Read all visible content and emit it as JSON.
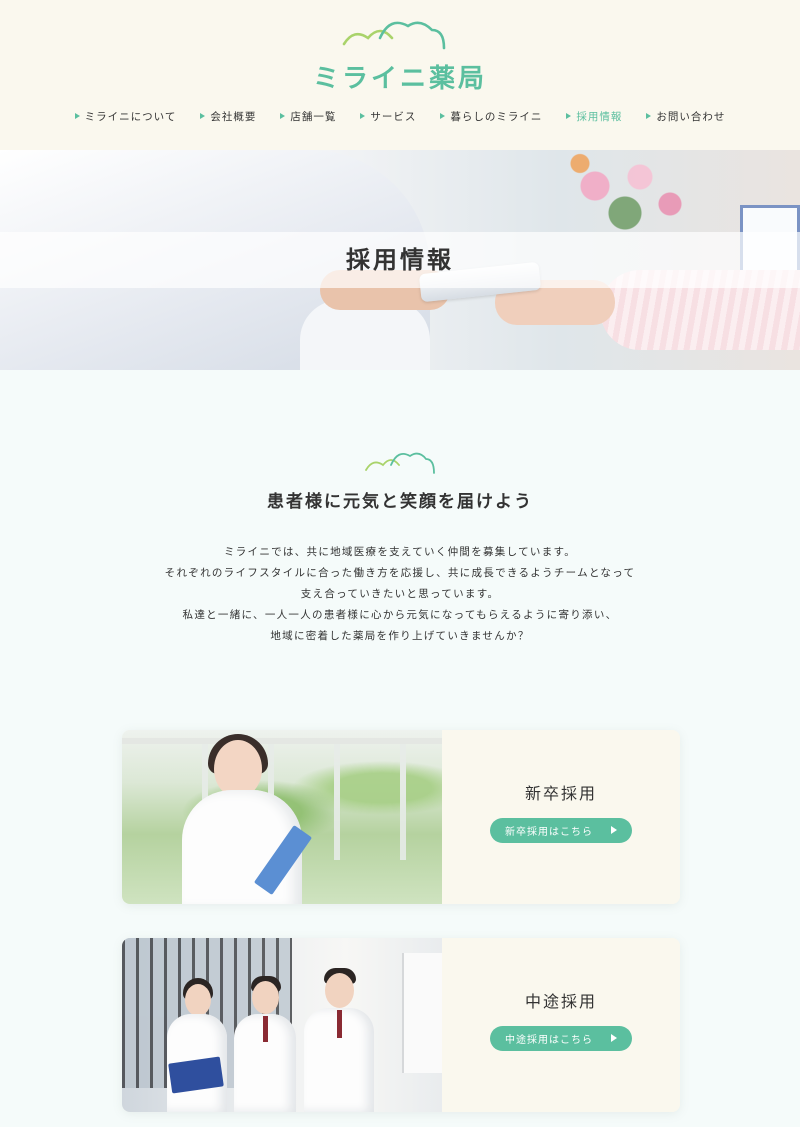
{
  "colors": {
    "accent": "#5bbf9f",
    "header_bg": "#faf8ee",
    "page_bg": "#f5fbfa",
    "text": "#333333"
  },
  "logo": {
    "text": "ミライニ薬局"
  },
  "nav": {
    "items": [
      {
        "label": "ミライニについて"
      },
      {
        "label": "会社概要"
      },
      {
        "label": "店舗一覧"
      },
      {
        "label": "サービス"
      },
      {
        "label": "暮らしのミライニ"
      },
      {
        "label": "採用情報",
        "active": true
      },
      {
        "label": "お問い合わせ"
      }
    ]
  },
  "hero": {
    "title": "採用情報"
  },
  "intro": {
    "heading": "患者様に元気と笑顔を届けよう",
    "lines": [
      "ミライニでは、共に地域医療を支えていく仲間を募集しています。",
      "それぞれのライフスタイルに合った働き方を応援し、共に成長できるようチームとなって",
      "支え合っていきたいと思っています。",
      "私達と一緒に、一人一人の患者様に心から元気になってもらえるように寄り添い、",
      "地域に密着した薬局を作り上げていきませんか？"
    ]
  },
  "cards": [
    {
      "title": "新卒採用",
      "button": "新卒採用はこちら"
    },
    {
      "title": "中途採用",
      "button": "中途採用はこちら"
    }
  ]
}
